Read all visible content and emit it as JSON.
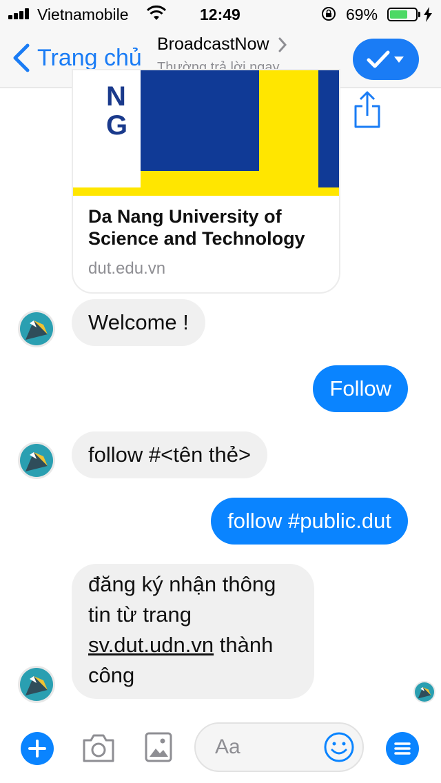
{
  "status_bar": {
    "carrier": "Vietnamobile",
    "time": "12:49",
    "battery_percent": "69%",
    "battery_level": 0.69,
    "icons": [
      "signal-icon",
      "wifi-icon",
      "rotation-lock-icon",
      "battery-icon",
      "charging-icon"
    ]
  },
  "nav": {
    "back_label": "Trang chủ",
    "title": "BroadcastNow",
    "subtitle": "Thường trả lời ngay",
    "icons": [
      "back-chevron-icon",
      "title-chevron-icon",
      "check-icon",
      "caret-down-icon"
    ]
  },
  "link_card": {
    "logo_letters": [
      "N",
      "G"
    ],
    "title": "Da Nang University of Science and Technology",
    "domain": "dut.edu.vn"
  },
  "messages": [
    {
      "from": "bot",
      "text": "Welcome !"
    },
    {
      "from": "user",
      "text": "Follow"
    },
    {
      "from": "bot",
      "text": "follow #<tên thẻ>"
    },
    {
      "from": "user",
      "text": "follow #public.dut"
    },
    {
      "from": "bot",
      "text_before": "đăng ký nhận thông tin từ trang",
      "link": "sv.dut.udn.vn",
      "text_after": "thành công"
    }
  ],
  "composer": {
    "placeholder": "Aa",
    "icons": [
      "plus-icon",
      "camera-icon",
      "image-icon",
      "emoji-icon",
      "menu-icon"
    ]
  },
  "colors": {
    "accent": "#0a84ff",
    "incoming_bubble": "#f0f0f0",
    "avatar": "#2a9fb1",
    "logo_yellow": "#ffe600",
    "logo_blue": "#103a96"
  }
}
